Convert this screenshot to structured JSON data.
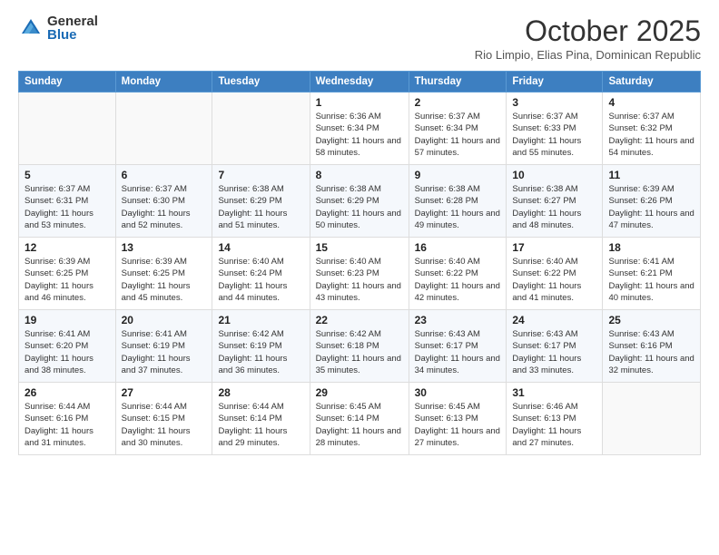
{
  "logo": {
    "general": "General",
    "blue": "Blue"
  },
  "header": {
    "month": "October 2025",
    "location": "Rio Limpio, Elias Pina, Dominican Republic"
  },
  "days_of_week": [
    "Sunday",
    "Monday",
    "Tuesday",
    "Wednesday",
    "Thursday",
    "Friday",
    "Saturday"
  ],
  "weeks": [
    [
      {
        "day": "",
        "sunrise": "",
        "sunset": "",
        "daylight": ""
      },
      {
        "day": "",
        "sunrise": "",
        "sunset": "",
        "daylight": ""
      },
      {
        "day": "",
        "sunrise": "",
        "sunset": "",
        "daylight": ""
      },
      {
        "day": "1",
        "sunrise": "Sunrise: 6:36 AM",
        "sunset": "Sunset: 6:34 PM",
        "daylight": "Daylight: 11 hours and 58 minutes."
      },
      {
        "day": "2",
        "sunrise": "Sunrise: 6:37 AM",
        "sunset": "Sunset: 6:34 PM",
        "daylight": "Daylight: 11 hours and 57 minutes."
      },
      {
        "day": "3",
        "sunrise": "Sunrise: 6:37 AM",
        "sunset": "Sunset: 6:33 PM",
        "daylight": "Daylight: 11 hours and 55 minutes."
      },
      {
        "day": "4",
        "sunrise": "Sunrise: 6:37 AM",
        "sunset": "Sunset: 6:32 PM",
        "daylight": "Daylight: 11 hours and 54 minutes."
      }
    ],
    [
      {
        "day": "5",
        "sunrise": "Sunrise: 6:37 AM",
        "sunset": "Sunset: 6:31 PM",
        "daylight": "Daylight: 11 hours and 53 minutes."
      },
      {
        "day": "6",
        "sunrise": "Sunrise: 6:37 AM",
        "sunset": "Sunset: 6:30 PM",
        "daylight": "Daylight: 11 hours and 52 minutes."
      },
      {
        "day": "7",
        "sunrise": "Sunrise: 6:38 AM",
        "sunset": "Sunset: 6:29 PM",
        "daylight": "Daylight: 11 hours and 51 minutes."
      },
      {
        "day": "8",
        "sunrise": "Sunrise: 6:38 AM",
        "sunset": "Sunset: 6:29 PM",
        "daylight": "Daylight: 11 hours and 50 minutes."
      },
      {
        "day": "9",
        "sunrise": "Sunrise: 6:38 AM",
        "sunset": "Sunset: 6:28 PM",
        "daylight": "Daylight: 11 hours and 49 minutes."
      },
      {
        "day": "10",
        "sunrise": "Sunrise: 6:38 AM",
        "sunset": "Sunset: 6:27 PM",
        "daylight": "Daylight: 11 hours and 48 minutes."
      },
      {
        "day": "11",
        "sunrise": "Sunrise: 6:39 AM",
        "sunset": "Sunset: 6:26 PM",
        "daylight": "Daylight: 11 hours and 47 minutes."
      }
    ],
    [
      {
        "day": "12",
        "sunrise": "Sunrise: 6:39 AM",
        "sunset": "Sunset: 6:25 PM",
        "daylight": "Daylight: 11 hours and 46 minutes."
      },
      {
        "day": "13",
        "sunrise": "Sunrise: 6:39 AM",
        "sunset": "Sunset: 6:25 PM",
        "daylight": "Daylight: 11 hours and 45 minutes."
      },
      {
        "day": "14",
        "sunrise": "Sunrise: 6:40 AM",
        "sunset": "Sunset: 6:24 PM",
        "daylight": "Daylight: 11 hours and 44 minutes."
      },
      {
        "day": "15",
        "sunrise": "Sunrise: 6:40 AM",
        "sunset": "Sunset: 6:23 PM",
        "daylight": "Daylight: 11 hours and 43 minutes."
      },
      {
        "day": "16",
        "sunrise": "Sunrise: 6:40 AM",
        "sunset": "Sunset: 6:22 PM",
        "daylight": "Daylight: 11 hours and 42 minutes."
      },
      {
        "day": "17",
        "sunrise": "Sunrise: 6:40 AM",
        "sunset": "Sunset: 6:22 PM",
        "daylight": "Daylight: 11 hours and 41 minutes."
      },
      {
        "day": "18",
        "sunrise": "Sunrise: 6:41 AM",
        "sunset": "Sunset: 6:21 PM",
        "daylight": "Daylight: 11 hours and 40 minutes."
      }
    ],
    [
      {
        "day": "19",
        "sunrise": "Sunrise: 6:41 AM",
        "sunset": "Sunset: 6:20 PM",
        "daylight": "Daylight: 11 hours and 38 minutes."
      },
      {
        "day": "20",
        "sunrise": "Sunrise: 6:41 AM",
        "sunset": "Sunset: 6:19 PM",
        "daylight": "Daylight: 11 hours and 37 minutes."
      },
      {
        "day": "21",
        "sunrise": "Sunrise: 6:42 AM",
        "sunset": "Sunset: 6:19 PM",
        "daylight": "Daylight: 11 hours and 36 minutes."
      },
      {
        "day": "22",
        "sunrise": "Sunrise: 6:42 AM",
        "sunset": "Sunset: 6:18 PM",
        "daylight": "Daylight: 11 hours and 35 minutes."
      },
      {
        "day": "23",
        "sunrise": "Sunrise: 6:43 AM",
        "sunset": "Sunset: 6:17 PM",
        "daylight": "Daylight: 11 hours and 34 minutes."
      },
      {
        "day": "24",
        "sunrise": "Sunrise: 6:43 AM",
        "sunset": "Sunset: 6:17 PM",
        "daylight": "Daylight: 11 hours and 33 minutes."
      },
      {
        "day": "25",
        "sunrise": "Sunrise: 6:43 AM",
        "sunset": "Sunset: 6:16 PM",
        "daylight": "Daylight: 11 hours and 32 minutes."
      }
    ],
    [
      {
        "day": "26",
        "sunrise": "Sunrise: 6:44 AM",
        "sunset": "Sunset: 6:16 PM",
        "daylight": "Daylight: 11 hours and 31 minutes."
      },
      {
        "day": "27",
        "sunrise": "Sunrise: 6:44 AM",
        "sunset": "Sunset: 6:15 PM",
        "daylight": "Daylight: 11 hours and 30 minutes."
      },
      {
        "day": "28",
        "sunrise": "Sunrise: 6:44 AM",
        "sunset": "Sunset: 6:14 PM",
        "daylight": "Daylight: 11 hours and 29 minutes."
      },
      {
        "day": "29",
        "sunrise": "Sunrise: 6:45 AM",
        "sunset": "Sunset: 6:14 PM",
        "daylight": "Daylight: 11 hours and 28 minutes."
      },
      {
        "day": "30",
        "sunrise": "Sunrise: 6:45 AM",
        "sunset": "Sunset: 6:13 PM",
        "daylight": "Daylight: 11 hours and 27 minutes."
      },
      {
        "day": "31",
        "sunrise": "Sunrise: 6:46 AM",
        "sunset": "Sunset: 6:13 PM",
        "daylight": "Daylight: 11 hours and 27 minutes."
      },
      {
        "day": "",
        "sunrise": "",
        "sunset": "",
        "daylight": ""
      }
    ]
  ]
}
